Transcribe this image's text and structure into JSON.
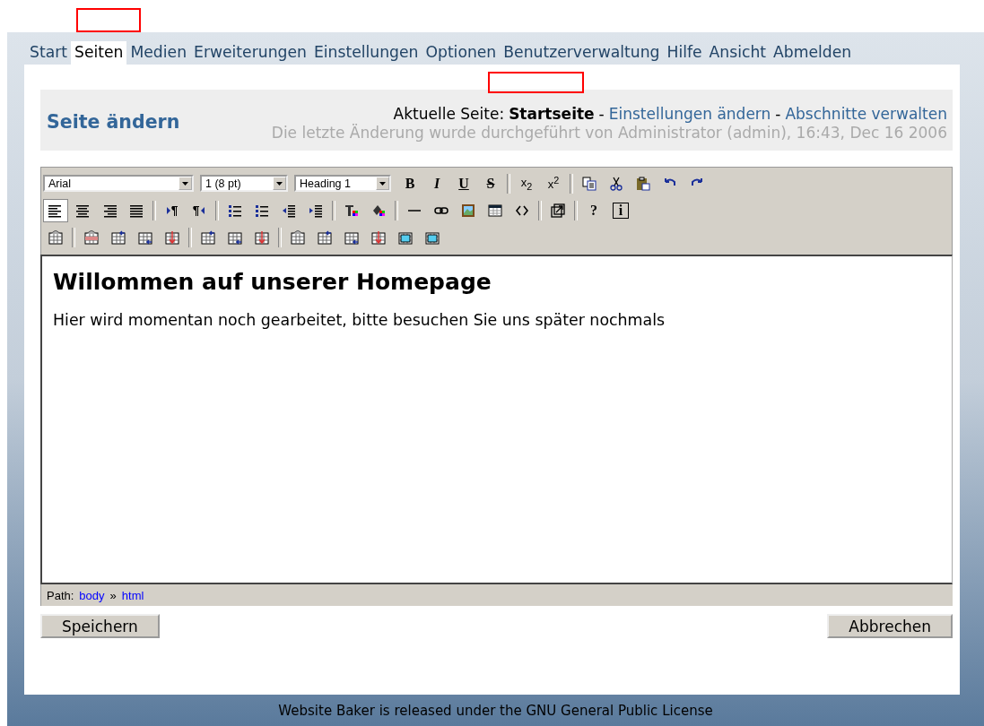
{
  "nav": [
    {
      "label": "Start",
      "selected": false
    },
    {
      "label": "Seiten",
      "selected": true
    },
    {
      "label": "Medien",
      "selected": false
    },
    {
      "label": "Erweiterungen",
      "selected": false
    },
    {
      "label": "Einstellungen",
      "selected": false
    },
    {
      "label": "Optionen",
      "selected": false
    },
    {
      "label": "Benutzerverwaltung",
      "selected": false
    },
    {
      "label": "Hilfe",
      "selected": false
    },
    {
      "label": "Ansicht",
      "selected": false
    },
    {
      "label": "Abmelden",
      "selected": false
    }
  ],
  "header": {
    "title": "Seite ändern",
    "current_label": "Aktuelle Seite:",
    "current_page": "Startseite",
    "links": [
      {
        "separator": "-",
        "label": "Einstellungen ändern"
      },
      {
        "separator": "-",
        "label": "Abschnitte verwalten"
      }
    ],
    "last_change": "Die letzte Änderung wurde durchgeführt von Administrator (admin), 16:43, Dec 16 2006"
  },
  "toolbar": [
    [
      {
        "kind": "select",
        "value": "Arial"
      },
      {
        "kind": "select",
        "value": "1 (8 pt)"
      },
      {
        "kind": "select",
        "value": "Heading 1"
      },
      {
        "kind": "bold",
        "text": "B"
      },
      {
        "kind": "italic",
        "text": "I"
      },
      {
        "kind": "underline",
        "text": "U"
      },
      {
        "kind": "strike",
        "text": "S"
      },
      {
        "kind": "separator"
      },
      {
        "kind": "subscript",
        "text": "x$_{2}$"
      },
      {
        "kind": "superscript",
        "text": "x$^{2}$"
      },
      {
        "kind": "separator"
      },
      {
        "kind": "copy",
        "active": false
      },
      {
        "kind": "cut",
        "active": false
      },
      {
        "kind": "paste",
        "active": false
      },
      {
        "kind": "undo",
        "active": false
      },
      {
        "kind": "redo",
        "active": false
      }
    ],
    [
      {
        "kind": "alignleft",
        "active": true
      },
      {
        "kind": "aligncenter",
        "active": false
      },
      {
        "kind": "alignright",
        "active": false
      },
      {
        "kind": "alignfull",
        "active": false
      },
      {
        "kind": "separator"
      },
      {
        "kind": "ltr",
        "active": false
      },
      {
        "kind": "rtl",
        "active": false
      },
      {
        "kind": "separator"
      },
      {
        "kind": "numlist",
        "active": false
      },
      {
        "kind": "bullist",
        "active": false
      },
      {
        "kind": "outdent",
        "active": false
      },
      {
        "kind": "indent",
        "active": false
      },
      {
        "kind": "separator"
      },
      {
        "kind": "forecolor",
        "active": false
      },
      {
        "kind": "backcolor",
        "active": false
      },
      {
        "kind": "separator"
      },
      {
        "kind": "hr",
        "active": false
      },
      {
        "kind": "link",
        "active": false
      },
      {
        "kind": "image",
        "active": false
      },
      {
        "kind": "table",
        "active": false
      },
      {
        "kind": "code",
        "active": false
      },
      {
        "kind": "separator"
      },
      {
        "kind": "fullscreen",
        "active": false
      },
      {
        "kind": "separator"
      },
      {
        "kind": "help",
        "text": "?"
      },
      {
        "kind": "info",
        "text": "i"
      }
    ],
    [
      {
        "kind": "tableprops",
        "active": false
      },
      {
        "kind": "separator"
      },
      {
        "kind": "rowprops",
        "active": false
      },
      {
        "kind": "rowbefore",
        "active": false
      },
      {
        "kind": "rowafter",
        "active": false
      },
      {
        "kind": "rowdelete",
        "active": false
      },
      {
        "kind": "separator"
      },
      {
        "kind": "colbefore",
        "active": false
      },
      {
        "kind": "colafter",
        "active": false
      },
      {
        "kind": "coldelete",
        "active": false
      },
      {
        "kind": "separator"
      },
      {
        "kind": "cellprops",
        "active": false
      },
      {
        "kind": "cellbefore",
        "active": false
      },
      {
        "kind": "cellafter",
        "active": false
      },
      {
        "kind": "celldelete",
        "active": false
      },
      {
        "kind": "split",
        "active": false
      },
      {
        "kind": "merge",
        "active": false
      }
    ]
  ],
  "editor": {
    "heading": "Willommen auf unserer Homepage",
    "paragraph": "Hier wird momentan noch gearbeitet, bitte besuchen Sie uns später nochmals"
  },
  "path": {
    "label": "Path:",
    "items": [
      {
        "label": "body"
      },
      {
        "separator": "»",
        "label": "html"
      }
    ]
  },
  "buttons": {
    "save": "Speichern",
    "cancel": "Abbrechen"
  },
  "footer": "Website Baker is released under the GNU General Public License"
}
